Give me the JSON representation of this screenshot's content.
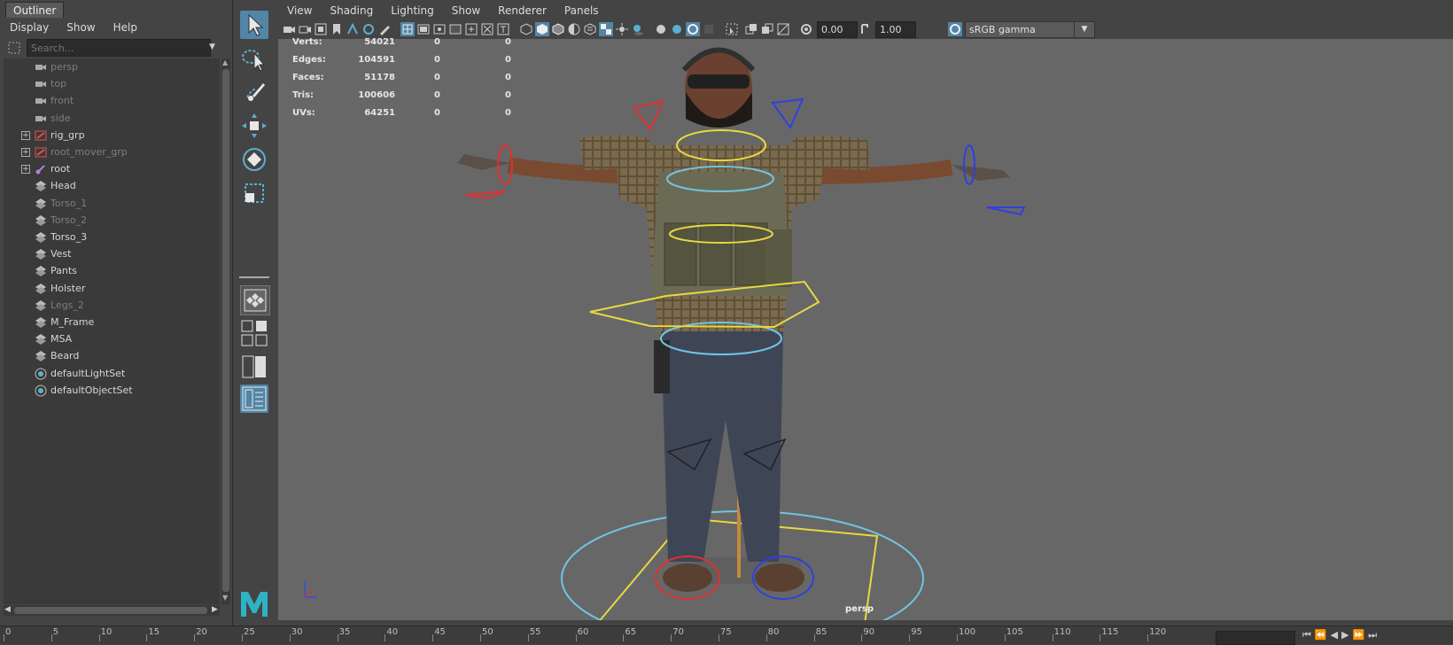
{
  "outliner": {
    "tab": "Outliner",
    "menu": [
      "Display",
      "Show",
      "Help"
    ],
    "search_placeholder": "Search...",
    "items": [
      {
        "label": "persp",
        "icon": "camera-icon",
        "expandable": false,
        "dim": true
      },
      {
        "label": "top",
        "icon": "camera-icon",
        "expandable": false,
        "dim": true
      },
      {
        "label": "front",
        "icon": "camera-icon",
        "expandable": false,
        "dim": true
      },
      {
        "label": "side",
        "icon": "camera-icon",
        "expandable": false,
        "dim": true
      },
      {
        "label": "rig_grp",
        "icon": "group-icon",
        "expandable": true,
        "dim": false
      },
      {
        "label": "root_mover_grp",
        "icon": "group-icon",
        "expandable": true,
        "dim": true
      },
      {
        "label": "root",
        "icon": "joint-icon",
        "expandable": true,
        "dim": false
      },
      {
        "label": "Head",
        "icon": "mesh-icon",
        "expandable": false,
        "dim": false
      },
      {
        "label": "Torso_1",
        "icon": "mesh-icon",
        "expandable": false,
        "dim": true
      },
      {
        "label": "Torso_2",
        "icon": "mesh-icon",
        "expandable": false,
        "dim": true
      },
      {
        "label": "Torso_3",
        "icon": "mesh-icon",
        "expandable": false,
        "dim": false
      },
      {
        "label": "Vest",
        "icon": "mesh-icon",
        "expandable": false,
        "dim": false
      },
      {
        "label": "Pants",
        "icon": "mesh-icon",
        "expandable": false,
        "dim": false
      },
      {
        "label": "Holster",
        "icon": "mesh-icon",
        "expandable": false,
        "dim": false
      },
      {
        "label": "Legs_2",
        "icon": "mesh-icon",
        "expandable": false,
        "dim": true
      },
      {
        "label": "M_Frame",
        "icon": "mesh-icon",
        "expandable": false,
        "dim": false
      },
      {
        "label": "MSA",
        "icon": "mesh-icon",
        "expandable": false,
        "dim": false
      },
      {
        "label": "Beard",
        "icon": "mesh-icon",
        "expandable": false,
        "dim": false
      },
      {
        "label": "defaultLightSet",
        "icon": "set-icon",
        "expandable": false,
        "dim": false
      },
      {
        "label": "defaultObjectSet",
        "icon": "set-icon",
        "expandable": false,
        "dim": false
      }
    ]
  },
  "panel_menu": [
    "View",
    "Shading",
    "Lighting",
    "Show",
    "Renderer",
    "Panels"
  ],
  "panel_toolbar": {
    "exposure": "0.00",
    "gamma": "1.00",
    "color_space": "sRGB gamma"
  },
  "hud": [
    {
      "label": "Verts:",
      "values": [
        "54021",
        "0",
        "0"
      ]
    },
    {
      "label": "Edges:",
      "values": [
        "104591",
        "0",
        "0"
      ]
    },
    {
      "label": "Faces:",
      "values": [
        "51178",
        "0",
        "0"
      ]
    },
    {
      "label": "Tris:",
      "values": [
        "100606",
        "0",
        "0"
      ]
    },
    {
      "label": "UVs:",
      "values": [
        "64251",
        "0",
        "0"
      ]
    }
  ],
  "camera_label": "persp",
  "timeline": {
    "ticks": [
      "0",
      "5",
      "10",
      "15",
      "20",
      "25",
      "30",
      "35",
      "40",
      "45",
      "50",
      "55",
      "60",
      "65",
      "70",
      "75",
      "80",
      "85",
      "90",
      "95",
      "100",
      "105",
      "110",
      "115",
      "120"
    ]
  },
  "colors": {
    "accent": "#5285a6",
    "viewport_bg": "#676767",
    "panel_bg": "#444444"
  }
}
